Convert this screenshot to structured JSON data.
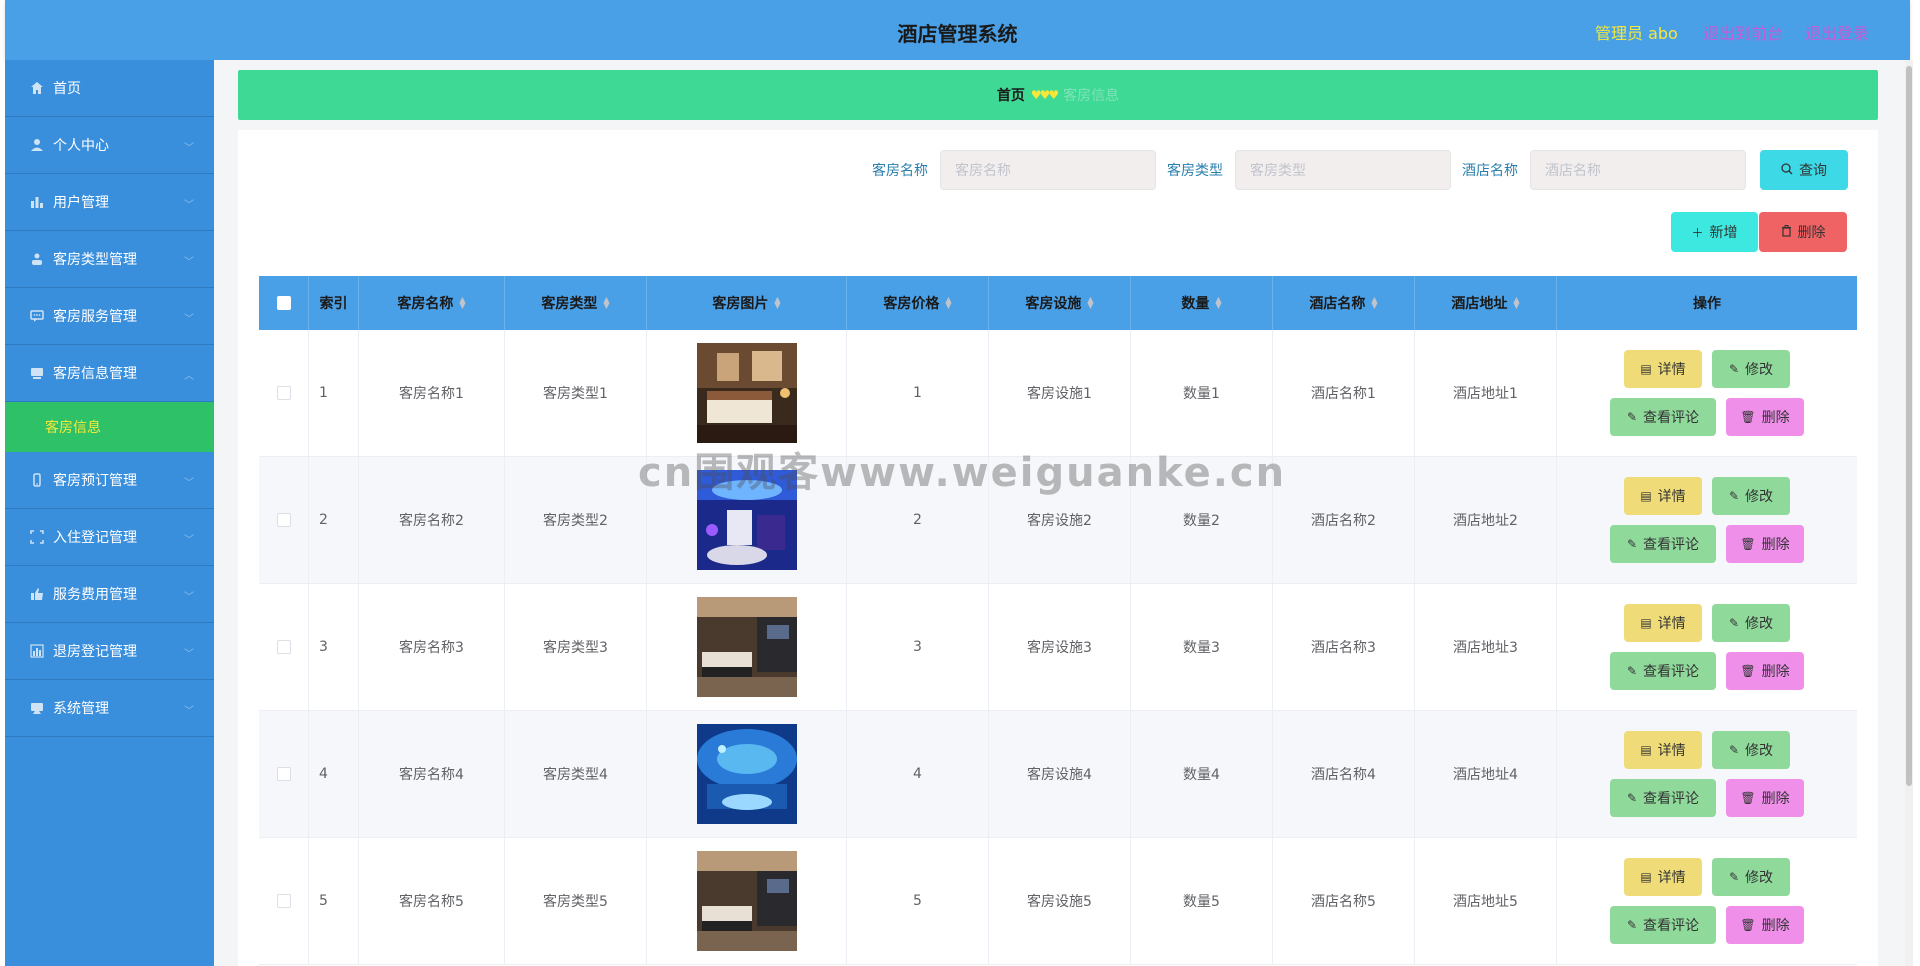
{
  "header": {
    "title": "酒店管理系统",
    "admin_label": "管理员 abo",
    "back_front": "退出到前台",
    "logout": "退出登录"
  },
  "sidebar": {
    "items": [
      {
        "label": "首页",
        "icon": "home-icon"
      },
      {
        "label": "个人中心",
        "icon": "user-icon"
      },
      {
        "label": "用户管理",
        "icon": "bar-chart-icon"
      },
      {
        "label": "客房类型管理",
        "icon": "person-icon"
      },
      {
        "label": "客房服务管理",
        "icon": "chat-icon"
      },
      {
        "label": "客房信息管理",
        "icon": "box-icon"
      },
      {
        "label": "客房预订管理",
        "icon": "phone-icon"
      },
      {
        "label": "入住登记管理",
        "icon": "frame-icon"
      },
      {
        "label": "服务费用管理",
        "icon": "thumb-icon"
      },
      {
        "label": "退房登记管理",
        "icon": "chart-icon"
      },
      {
        "label": "系统管理",
        "icon": "monitor-icon"
      }
    ],
    "active_sub": "客房信息"
  },
  "breadcrumb": {
    "home": "首页",
    "current": "客房信息"
  },
  "search": {
    "room_name_label": "客房名称",
    "room_name_placeholder": "客房名称",
    "room_type_label": "客房类型",
    "room_type_placeholder": "客房类型",
    "hotel_name_label": "酒店名称",
    "hotel_name_placeholder": "酒店名称",
    "query_button": "查询"
  },
  "toolbar": {
    "add_button": "新增",
    "delete_button": "删除"
  },
  "table": {
    "columns": [
      "索引",
      "客房名称",
      "客房类型",
      "客房图片",
      "客房价格",
      "客房设施",
      "数量",
      "酒店名称",
      "酒店地址",
      "操作"
    ],
    "rows": [
      {
        "index": "1",
        "name": "客房名称1",
        "type": "客房类型1",
        "price": "1",
        "facility": "客房设施1",
        "qty": "数量1",
        "hotel": "酒店名称1",
        "address": "酒店地址1"
      },
      {
        "index": "2",
        "name": "客房名称2",
        "type": "客房类型2",
        "price": "2",
        "facility": "客房设施2",
        "qty": "数量2",
        "hotel": "酒店名称2",
        "address": "酒店地址2"
      },
      {
        "index": "3",
        "name": "客房名称3",
        "type": "客房类型3",
        "price": "3",
        "facility": "客房设施3",
        "qty": "数量3",
        "hotel": "酒店名称3",
        "address": "酒店地址3"
      },
      {
        "index": "4",
        "name": "客房名称4",
        "type": "客房类型4",
        "price": "4",
        "facility": "客房设施4",
        "qty": "数量4",
        "hotel": "酒店名称4",
        "address": "酒店地址4"
      },
      {
        "index": "5",
        "name": "客房名称5",
        "type": "客房类型5",
        "price": "5",
        "facility": "客房设施5",
        "qty": "数量5",
        "hotel": "酒店名称5",
        "address": "酒店地址5"
      }
    ],
    "ops": {
      "detail": "详情",
      "edit": "修改",
      "review": "查看评论",
      "delete": "删除"
    }
  },
  "watermark": "cn围观客www.weiguanke.cn",
  "colors": {
    "header": "#4aa0e6",
    "sidebar": "#3a8fdc",
    "active_sub": "#2ec167",
    "breadcrumb": "#3ed994",
    "query": "#3ed9e6",
    "delete": "#f06365"
  }
}
